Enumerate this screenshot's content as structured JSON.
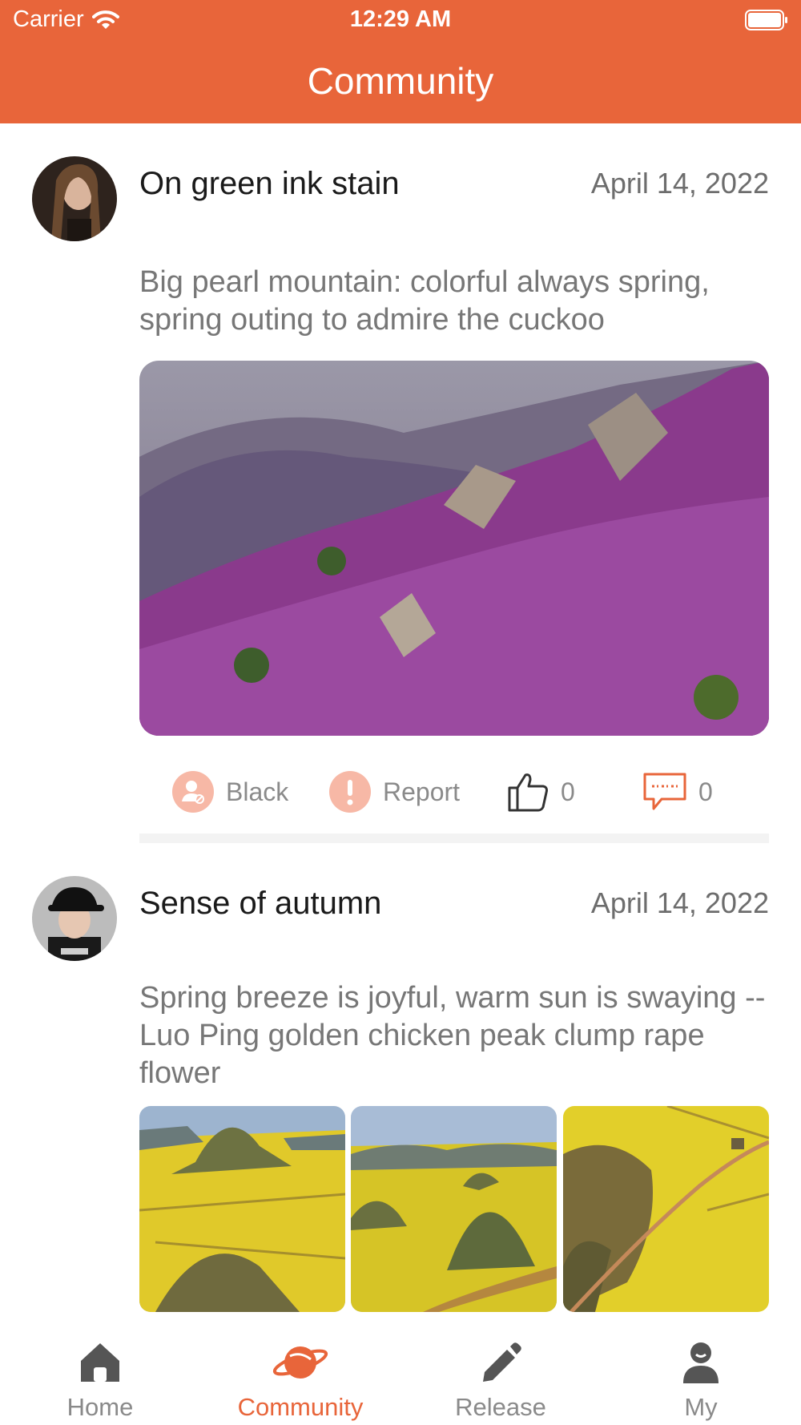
{
  "status_bar": {
    "carrier": "Carrier",
    "time": "12:29 AM"
  },
  "header": {
    "title": "Community"
  },
  "posts": [
    {
      "username": "On green ink stain",
      "date": "April 14, 2022",
      "content": "Big pearl mountain: colorful always spring, spring outing to admire the cuckoo",
      "actions": {
        "black": "Black",
        "report": "Report",
        "likes": "0",
        "comments": "0"
      }
    },
    {
      "username": "Sense of autumn",
      "date": "April 14, 2022",
      "content": "Spring breeze is joyful, warm sun is swaying -- Luo Ping golden chicken peak clump rape flower"
    }
  ],
  "tabs": [
    {
      "label": "Home",
      "icon": "home-icon"
    },
    {
      "label": "Community",
      "icon": "planet-icon"
    },
    {
      "label": "Release",
      "icon": "pencil-icon"
    },
    {
      "label": "My",
      "icon": "person-icon"
    }
  ],
  "colors": {
    "accent": "#e8653a",
    "secondary_text": "#777777"
  }
}
